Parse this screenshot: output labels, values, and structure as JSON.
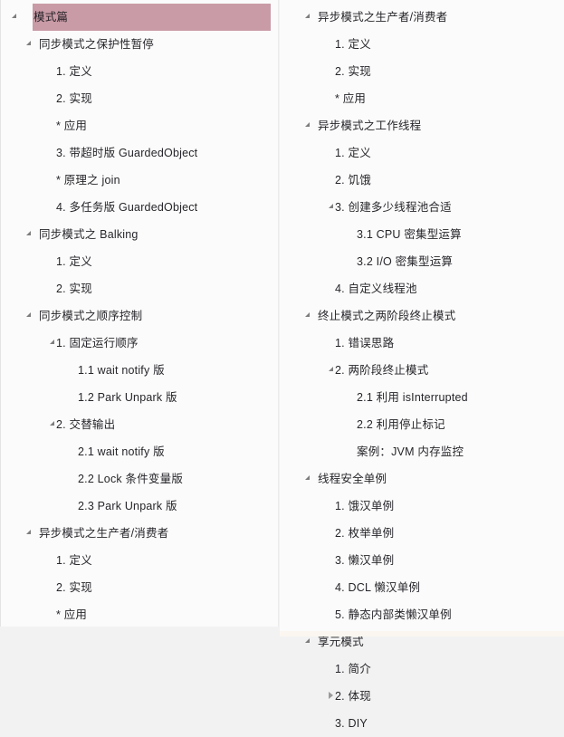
{
  "document": {
    "title": "模式篇",
    "accent_highlight_color": "#c99ba6",
    "text_color": "#26262b",
    "page_background": "#f2f2f2",
    "panel_background": "#fbfbfb"
  },
  "icons": {
    "expanded": "triangle-down-icon",
    "collapsed": "triangle-right-icon",
    "none": "no-twisty"
  },
  "columns": [
    {
      "name": "left-column",
      "items": [
        {
          "label": "模式篇",
          "level": 0,
          "twisty": "expanded",
          "highlight": true
        },
        {
          "label": "同步模式之保护性暂停",
          "level": 1,
          "twisty": "expanded",
          "highlight": false
        },
        {
          "label": "1. 定义",
          "level": 2,
          "twisty": "none",
          "highlight": false
        },
        {
          "label": "2. 实现",
          "level": 2,
          "twisty": "none",
          "highlight": false
        },
        {
          "label": "* 应用",
          "level": 2,
          "twisty": "none",
          "highlight": false
        },
        {
          "label": "3. 带超时版 GuardedObject",
          "level": 2,
          "twisty": "none",
          "highlight": false
        },
        {
          "label": "* 原理之 join",
          "level": 2,
          "twisty": "none",
          "highlight": false
        },
        {
          "label": "4. 多任务版 GuardedObject",
          "level": 2,
          "twisty": "none",
          "highlight": false
        },
        {
          "label": "同步模式之 Balking",
          "level": 1,
          "twisty": "expanded",
          "highlight": false
        },
        {
          "label": "1. 定义",
          "level": 2,
          "twisty": "none",
          "highlight": false
        },
        {
          "label": "2. 实现",
          "level": 2,
          "twisty": "none",
          "highlight": false
        },
        {
          "label": "同步模式之顺序控制",
          "level": 1,
          "twisty": "expanded",
          "highlight": false
        },
        {
          "label": "1. 固定运行顺序",
          "level": 2,
          "twisty": "expanded",
          "highlight": false
        },
        {
          "label": "1.1 wait notify 版",
          "level": 3,
          "twisty": "none",
          "highlight": false
        },
        {
          "label": "1.2 Park Unpark 版",
          "level": 3,
          "twisty": "none",
          "highlight": false
        },
        {
          "label": "2. 交替输出",
          "level": 2,
          "twisty": "expanded",
          "highlight": false
        },
        {
          "label": "2.1 wait notify 版",
          "level": 3,
          "twisty": "none",
          "highlight": false
        },
        {
          "label": "2.2 Lock 条件变量版",
          "level": 3,
          "twisty": "none",
          "highlight": false
        },
        {
          "label": "2.3 Park Unpark 版",
          "level": 3,
          "twisty": "none",
          "highlight": false
        },
        {
          "label": "异步模式之生产者/消费者",
          "level": 1,
          "twisty": "expanded",
          "highlight": false
        },
        {
          "label": "1. 定义",
          "level": 2,
          "twisty": "none",
          "highlight": false
        },
        {
          "label": "2. 实现",
          "level": 2,
          "twisty": "none",
          "highlight": false
        },
        {
          "label": "* 应用",
          "level": 2,
          "twisty": "none",
          "highlight": false
        }
      ]
    },
    {
      "name": "right-column",
      "items": [
        {
          "label": "异步模式之生产者/消费者",
          "level": 1,
          "twisty": "expanded",
          "highlight": false
        },
        {
          "label": "1. 定义",
          "level": 2,
          "twisty": "none",
          "highlight": false
        },
        {
          "label": "2. 实现",
          "level": 2,
          "twisty": "none",
          "highlight": false
        },
        {
          "label": "* 应用",
          "level": 2,
          "twisty": "none",
          "highlight": false
        },
        {
          "label": "异步模式之工作线程",
          "level": 1,
          "twisty": "expanded",
          "highlight": false
        },
        {
          "label": "1. 定义",
          "level": 2,
          "twisty": "none",
          "highlight": false
        },
        {
          "label": "2. 饥饿",
          "level": 2,
          "twisty": "none",
          "highlight": false
        },
        {
          "label": "3. 创建多少线程池合适",
          "level": 2,
          "twisty": "expanded",
          "highlight": false
        },
        {
          "label": "3.1 CPU 密集型运算",
          "level": 3,
          "twisty": "none",
          "highlight": false
        },
        {
          "label": "3.2 I/O 密集型运算",
          "level": 3,
          "twisty": "none",
          "highlight": false
        },
        {
          "label": "4. 自定义线程池",
          "level": 2,
          "twisty": "none",
          "highlight": false
        },
        {
          "label": "终止模式之两阶段终止模式",
          "level": 1,
          "twisty": "expanded",
          "highlight": false
        },
        {
          "label": "1. 错误思路",
          "level": 2,
          "twisty": "none",
          "highlight": false
        },
        {
          "label": "2. 两阶段终止模式",
          "level": 2,
          "twisty": "expanded",
          "highlight": false
        },
        {
          "label": "2.1 利用 isInterrupted",
          "level": 3,
          "twisty": "none",
          "highlight": false
        },
        {
          "label": "2.2 利用停止标记",
          "level": 3,
          "twisty": "none",
          "highlight": false
        },
        {
          "label": "案例：JVM 内存监控",
          "level": 3,
          "twisty": "none",
          "highlight": false
        },
        {
          "label": "线程安全单例",
          "level": 1,
          "twisty": "expanded",
          "highlight": false
        },
        {
          "label": "1. 饿汉单例",
          "level": 2,
          "twisty": "none",
          "highlight": false
        },
        {
          "label": "2. 枚举单例",
          "level": 2,
          "twisty": "none",
          "highlight": false
        },
        {
          "label": "3. 懒汉单例",
          "level": 2,
          "twisty": "none",
          "highlight": false
        },
        {
          "label": "4. DCL 懒汉单例",
          "level": 2,
          "twisty": "none",
          "highlight": false
        },
        {
          "label": "5. 静态内部类懒汉单例",
          "level": 2,
          "twisty": "none",
          "highlight": false
        },
        {
          "label": "享元模式",
          "level": 1,
          "twisty": "expanded",
          "highlight": false
        },
        {
          "label": "1.  简介",
          "level": 2,
          "twisty": "none",
          "highlight": false
        },
        {
          "label": "2. 体现",
          "level": 2,
          "twisty": "collapsed",
          "highlight": false
        },
        {
          "label": "3. DIY",
          "level": 2,
          "twisty": "none",
          "highlight": false
        }
      ]
    }
  ]
}
